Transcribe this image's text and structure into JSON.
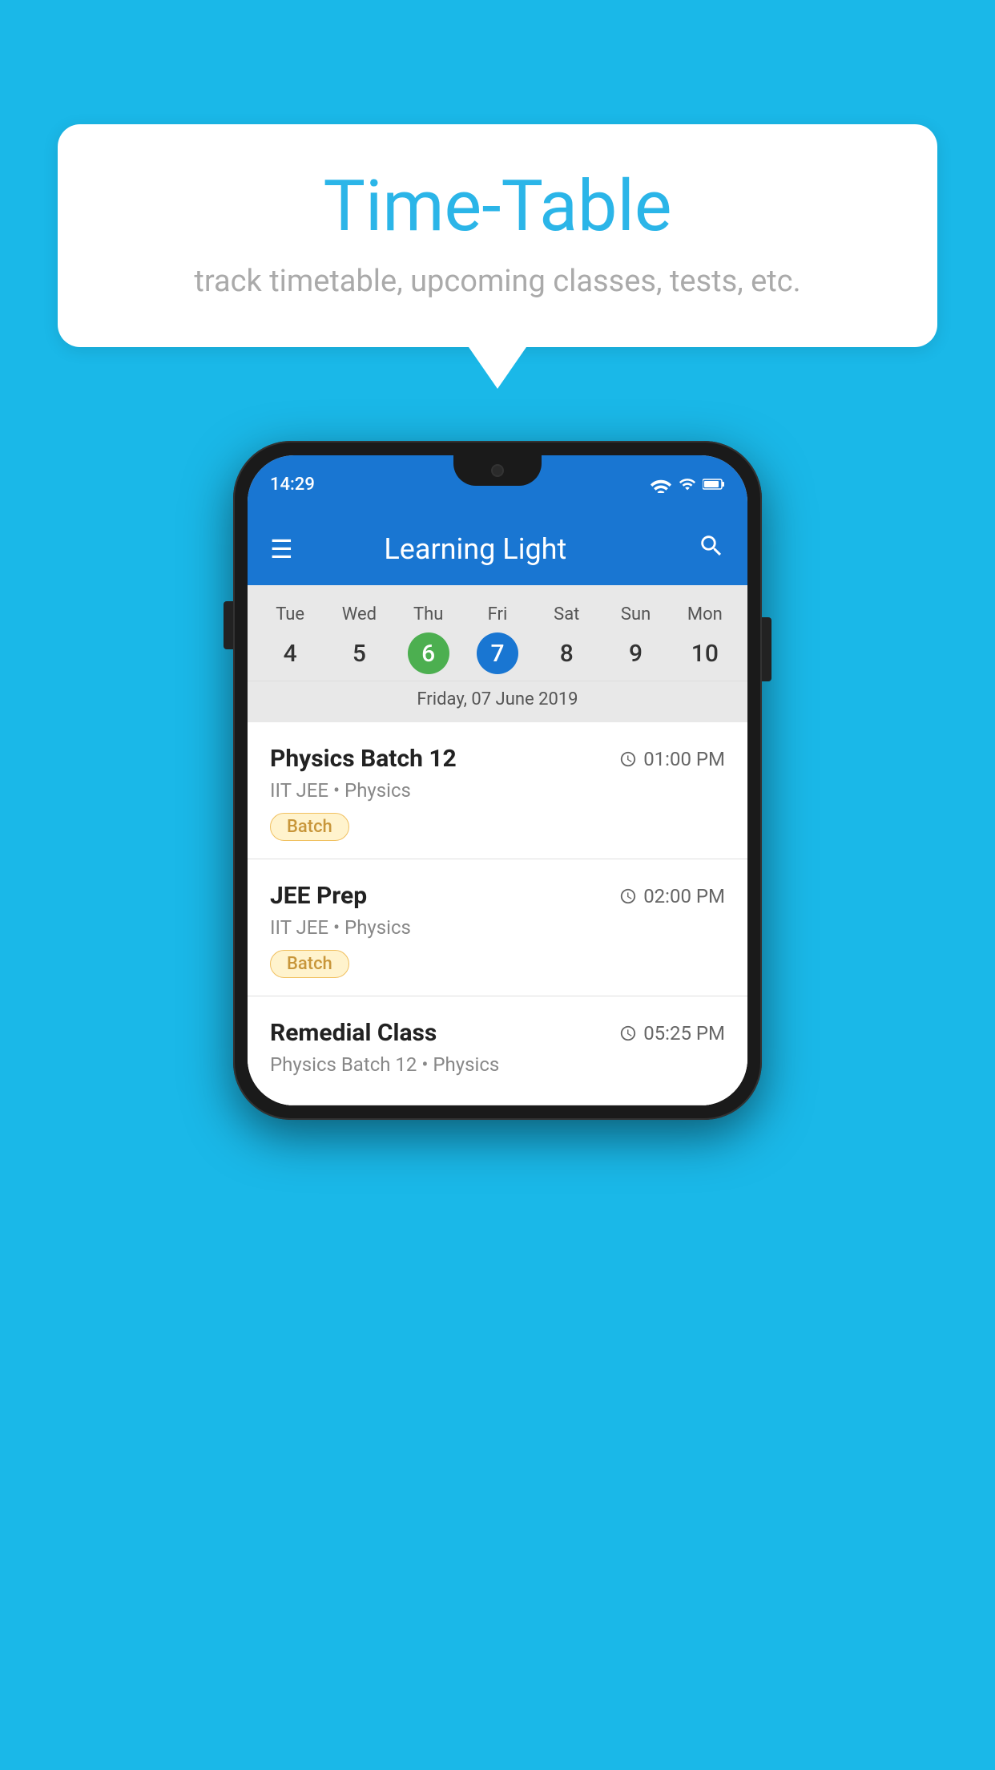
{
  "background_color": "#1ab8e8",
  "speech_bubble": {
    "title": "Time-Table",
    "subtitle": "track timetable, upcoming classes, tests, etc."
  },
  "phone": {
    "status_bar": {
      "time": "14:29"
    },
    "app_bar": {
      "title": "Learning Light"
    },
    "calendar": {
      "days": [
        {
          "name": "Tue",
          "number": "4",
          "state": "normal"
        },
        {
          "name": "Wed",
          "number": "5",
          "state": "normal"
        },
        {
          "name": "Thu",
          "number": "6",
          "state": "today"
        },
        {
          "name": "Fri",
          "number": "7",
          "state": "selected"
        },
        {
          "name": "Sat",
          "number": "8",
          "state": "normal"
        },
        {
          "name": "Sun",
          "number": "9",
          "state": "normal"
        },
        {
          "name": "Mon",
          "number": "10",
          "state": "normal"
        }
      ],
      "selected_date_label": "Friday, 07 June 2019"
    },
    "schedule_items": [
      {
        "title": "Physics Batch 12",
        "time": "01:00 PM",
        "subtitle": "IIT JEE • Physics",
        "tag": "Batch"
      },
      {
        "title": "JEE Prep",
        "time": "02:00 PM",
        "subtitle": "IIT JEE • Physics",
        "tag": "Batch"
      },
      {
        "title": "Remedial Class",
        "time": "05:25 PM",
        "subtitle": "Physics Batch 12 • Physics",
        "tag": null
      }
    ]
  },
  "icons": {
    "hamburger": "☰",
    "search": "🔍",
    "clock": "🕐"
  }
}
